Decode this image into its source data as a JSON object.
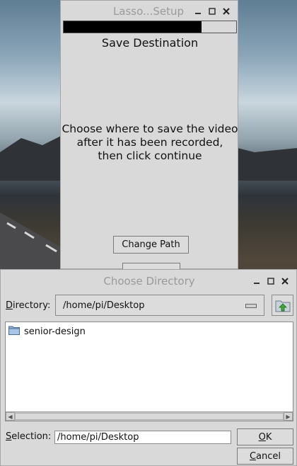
{
  "setup_window": {
    "title": "Lasso...Setup",
    "progress_fraction": 0.8,
    "heading": "Save Destination",
    "instructions": [
      "Choose where to save the video",
      "after it has been recorded,",
      "then click continue"
    ],
    "change_path_label": "Change Path"
  },
  "dialog": {
    "title": "Choose Directory",
    "directory_label_ul": "D",
    "directory_label_rest": "irectory:",
    "directory_value": "/home/pi/Desktop",
    "items": [
      {
        "name": "senior-design",
        "icon": "folder-icon"
      }
    ],
    "selection_label_ul": "S",
    "selection_label_rest": "election:",
    "selection_value": "/home/pi/Desktop",
    "ok_ul": "O",
    "ok_rest": "K",
    "cancel_ul": "C",
    "cancel_rest": "ancel"
  },
  "icons": {
    "minimize": "minimize-icon",
    "maximize": "maximize-icon",
    "close": "close-icon",
    "up_folder": "folder-up-icon"
  }
}
